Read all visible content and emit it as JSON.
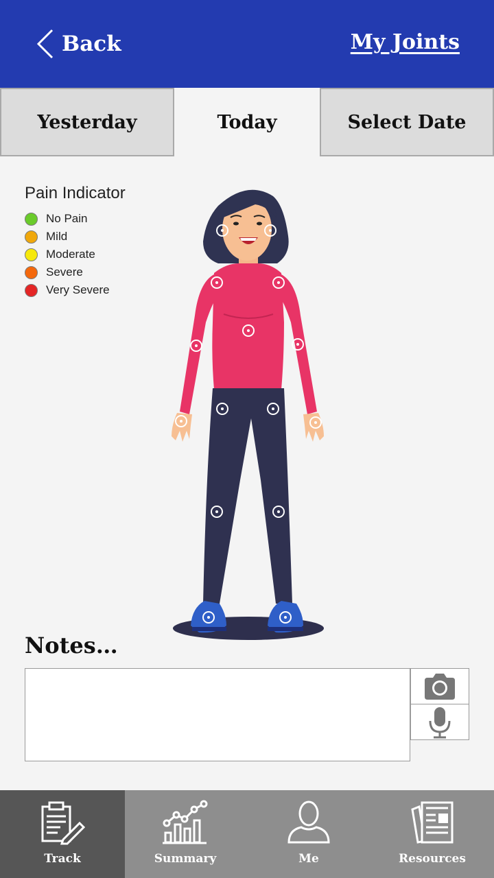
{
  "header": {
    "back_label": "Back",
    "title_link": "My Joints",
    "background": "#233bb0"
  },
  "tabs": [
    {
      "label": "Yesterday",
      "active": false
    },
    {
      "label": "Today",
      "active": true
    },
    {
      "label": "Select Date",
      "active": false
    }
  ],
  "legend": {
    "title": "Pain Indicator",
    "items": [
      {
        "label": "No Pain",
        "color": "#6acb2a"
      },
      {
        "label": "Mild",
        "color": "#f0a80c"
      },
      {
        "label": "Moderate",
        "color": "#f6e80b"
      },
      {
        "label": "Severe",
        "color": "#f4680c"
      },
      {
        "label": "Very Severe",
        "color": "#e42525"
      }
    ]
  },
  "figure": {
    "icon": "woman-body-figure",
    "joints": [
      "jaw-left",
      "jaw-right",
      "shoulder-left",
      "shoulder-right",
      "elbow-left",
      "elbow-right",
      "spine",
      "wrist-left",
      "wrist-right",
      "hip-left",
      "hip-right",
      "knee-left",
      "knee-right",
      "ankle-left",
      "ankle-right"
    ]
  },
  "notes": {
    "title": "Notes…",
    "value": "",
    "camera_icon": "camera-icon",
    "mic_icon": "microphone-icon"
  },
  "bottom_nav": [
    {
      "label": "Track",
      "icon": "clipboard-pen-icon",
      "active": true
    },
    {
      "label": "Summary",
      "icon": "bar-chart-icon",
      "active": false
    },
    {
      "label": "Me",
      "icon": "person-icon",
      "active": false
    },
    {
      "label": "Resources",
      "icon": "newspaper-icon",
      "active": false
    }
  ]
}
